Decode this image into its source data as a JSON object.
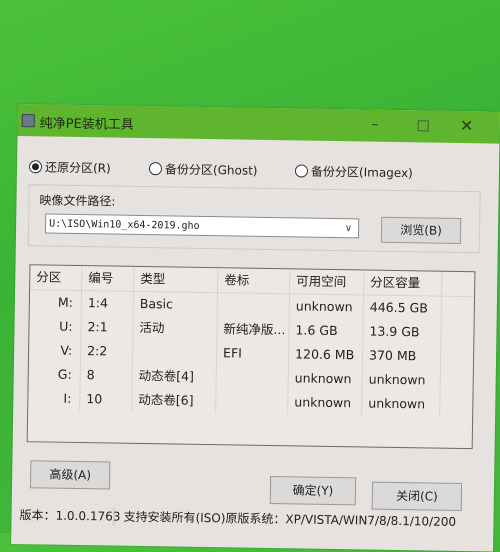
{
  "window": {
    "title": "纯净PE装机工具",
    "controls": {
      "minimize": "–",
      "maximize": "□",
      "close": "✕"
    },
    "icon": "app-icon"
  },
  "modes": [
    {
      "label": "还原分区(R)",
      "selected": true
    },
    {
      "label": "备份分区(Ghost)",
      "selected": false
    },
    {
      "label": "备份分区(Imagex)",
      "selected": false
    }
  ],
  "image_path": {
    "label": "映像文件路径:",
    "value": "U:\\ISO\\Win10_x64-2019.gho",
    "browse_label": "浏览(B)"
  },
  "partitions": {
    "columns": [
      "分区",
      "编号",
      "类型",
      "卷标",
      "可用空间",
      "分区容量"
    ],
    "rows": [
      [
        "M:",
        "1:4",
        "Basic",
        "",
        "unknown",
        "446.5 GB"
      ],
      [
        "U:",
        "2:1",
        "活动",
        "新纯净版...",
        "1.6 GB",
        "13.9 GB"
      ],
      [
        "V:",
        "2:2",
        "",
        "EFI",
        "120.6 MB",
        "370 MB"
      ],
      [
        "G:",
        "8",
        "动态卷[4]",
        "",
        "unknown",
        "unknown"
      ],
      [
        "I:",
        "10",
        "动态卷[6]",
        "",
        "unknown",
        "unknown"
      ]
    ]
  },
  "buttons": {
    "advanced": "高级(A)",
    "ok": "确定(Y)",
    "close": "关闭(C)"
  },
  "status": {
    "version": "版本：1.0.0.1763",
    "support": "支持安装所有(ISO)原版系统：XP/VISTA/WIN7/8/8.1/10/200"
  }
}
